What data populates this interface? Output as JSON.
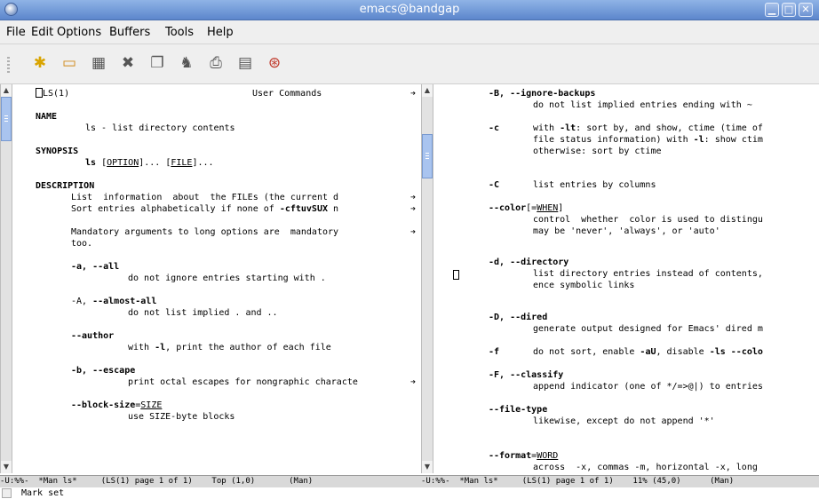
{
  "window": {
    "title": "emacs@bandgap",
    "buttons": [
      "▁",
      "□",
      "✕"
    ]
  },
  "menu": [
    "File",
    "Edit",
    "Options",
    "Buffers",
    "Tools",
    "Help"
  ],
  "toolbar": [
    {
      "name": "new-file-icon",
      "glyph": "✱"
    },
    {
      "name": "open-folder-icon",
      "glyph": "▭"
    },
    {
      "name": "save-icon",
      "glyph": "▦"
    },
    {
      "name": "close-buffer-icon",
      "glyph": "✖"
    },
    {
      "name": "copy-icon",
      "glyph": "❐"
    },
    {
      "name": "search-icon",
      "glyph": "♞"
    },
    {
      "name": "print-icon",
      "glyph": "⎙"
    },
    {
      "name": "preferences-icon",
      "glyph": "▤"
    },
    {
      "name": "help-icon",
      "glyph": "⊛"
    }
  ],
  "left": {
    "header": {
      "name": "LS(1)",
      "center": "User Commands"
    },
    "name_title": "NAME",
    "name_text": "ls - list directory contents",
    "synopsis_title": "SYNOPSIS",
    "synopsis_cmd": "ls",
    "synopsis_opt": "OPTION",
    "synopsis_dots1": "...",
    "synopsis_file": "FILE",
    "synopsis_dots2": "...",
    "desc_title": "DESCRIPTION",
    "desc_line1": "List  information  about  the FILEs (the current d",
    "desc_line2_pre": "Sort entries alphabetically if none of ",
    "desc_line2_b": "-cftuvSUX",
    "desc_line2_post": " n",
    "mand_line1": "Mandatory arguments to long options are  mandatory",
    "mand_line2": "too.",
    "opt_a": "-a, --all",
    "opt_a_desc": "do not ignore entries starting with .",
    "opt_A_short": "-A, ",
    "opt_A": "--almost-all",
    "opt_A_desc": "do not list implied . and ..",
    "opt_author": "--author",
    "opt_author_desc_pre": "with ",
    "opt_author_desc_b": "-l",
    "opt_author_desc_post": ", print the author of each file",
    "opt_b": "-b, --escape",
    "opt_b_desc": "print octal escapes for nongraphic characte",
    "opt_bs": "--block-size",
    "opt_bs_eq": "=",
    "opt_bs_arg": "SIZE",
    "opt_bs_desc": "use SIZE-byte blocks"
  },
  "right": {
    "B": "-B, --ignore-backups",
    "B_desc": "do not list implied entries ending with ~",
    "c": "-c",
    "c_l1_pre": "with ",
    "c_l1_b": "-lt",
    "c_l1_post": ": sort by, and show, ctime (time of",
    "c_l2_pre": "file status information) with ",
    "c_l2_b": "-l",
    "c_l2_post": ": show ctim",
    "c_l3": "otherwise: sort by ctime",
    "C": "-C",
    "C_desc": "list entries by columns",
    "color": "--color",
    "color_br1": "[=",
    "color_arg": "WHEN",
    "color_br2": "]",
    "color_l1": "control  whether  color is used to distingu",
    "color_l2": "may be 'never', 'always', or 'auto'",
    "d": "-d, --directory",
    "d_l1": "list directory entries instead of contents,",
    "d_l2": "ence symbolic links",
    "D": "-D, --dired",
    "D_desc": "generate output designed for Emacs' dired m",
    "f": "-f",
    "f_pre": "do not sort, enable ",
    "f_b1": "-aU",
    "f_mid": ", disable ",
    "f_b2": "-ls --colo",
    "F": "-F, --classify",
    "F_desc": "append indicator (one of */=>@|) to entries",
    "ft": "--file-type",
    "ft_desc": "likewise, except do not append '*'",
    "fmt": "--format",
    "fmt_eq": "=",
    "fmt_arg": "WORD",
    "fmt_desc": "across  -x, commas -m, horizontal -x, long"
  },
  "cont_glyph": "➔",
  "modeline_left": "-U:%%-  *Man ls*     (LS(1) page 1 of 1)    Top (1,0)       (Man)",
  "modeline_right": "-U:%%-  *Man ls*     (LS(1) page 1 of 1)    11% (45,0)      (Man)",
  "minibuffer": "Mark set"
}
